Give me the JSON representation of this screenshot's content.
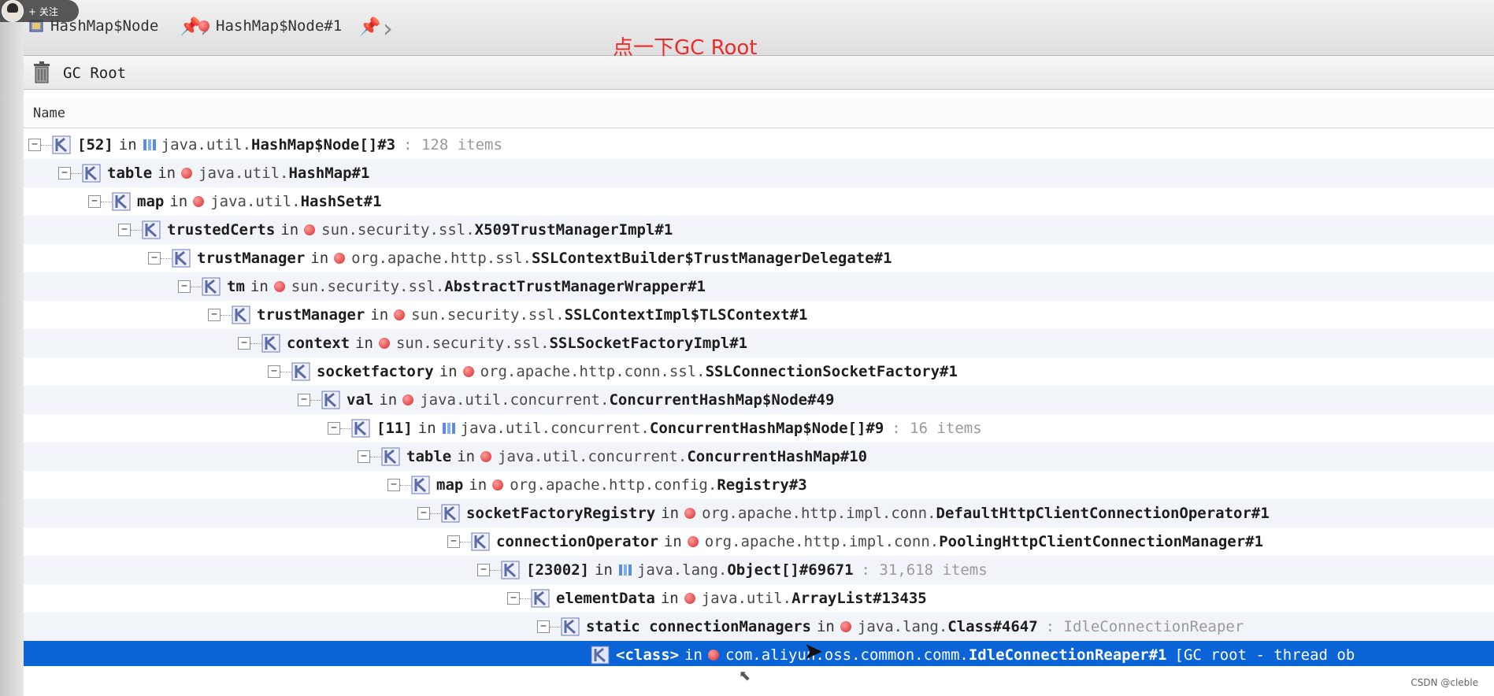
{
  "follow_badge": {
    "label": "+ 关注"
  },
  "breadcrumb": {
    "items": [
      {
        "label": "HashMap$Node"
      },
      {
        "label": "HashMap$Node#1"
      }
    ]
  },
  "annotation": "点一下GC Root",
  "gc_bar": {
    "label": "GC Root"
  },
  "column_header": {
    "name": "Name"
  },
  "tree": [
    {
      "field": "[52]",
      "in": "in",
      "pkg": "java.util.",
      "cls": "HashMap$Node[]#3",
      "extra": ": 128 items",
      "icon": "array"
    },
    {
      "field": "table",
      "in": "in",
      "pkg": "java.util.",
      "cls": "HashMap#1",
      "extra": "",
      "icon": "object"
    },
    {
      "field": "map",
      "in": "in",
      "pkg": "java.util.",
      "cls": "HashSet#1",
      "extra": "",
      "icon": "object"
    },
    {
      "field": "trustedCerts",
      "in": "in",
      "pkg": "sun.security.ssl.",
      "cls": "X509TrustManagerImpl#1",
      "extra": "",
      "icon": "object"
    },
    {
      "field": "trustManager",
      "in": "in",
      "pkg": "org.apache.http.ssl.",
      "cls": "SSLContextBuilder$TrustManagerDelegate#1",
      "extra": "",
      "icon": "object"
    },
    {
      "field": "tm",
      "in": "in",
      "pkg": "sun.security.ssl.",
      "cls": "AbstractTrustManagerWrapper#1",
      "extra": "",
      "icon": "object"
    },
    {
      "field": "trustManager",
      "in": "in",
      "pkg": "sun.security.ssl.",
      "cls": "SSLContextImpl$TLSContext#1",
      "extra": "",
      "icon": "object"
    },
    {
      "field": "context",
      "in": "in",
      "pkg": "sun.security.ssl.",
      "cls": "SSLSocketFactoryImpl#1",
      "extra": "",
      "icon": "object"
    },
    {
      "field": "socketfactory",
      "in": "in",
      "pkg": "org.apache.http.conn.ssl.",
      "cls": "SSLConnectionSocketFactory#1",
      "extra": "",
      "icon": "object"
    },
    {
      "field": "val",
      "in": "in",
      "pkg": "java.util.concurrent.",
      "cls": "ConcurrentHashMap$Node#49",
      "extra": "",
      "icon": "object"
    },
    {
      "field": "[11]",
      "in": "in",
      "pkg": "java.util.concurrent.",
      "cls": "ConcurrentHashMap$Node[]#9",
      "extra": ": 16 items",
      "icon": "array"
    },
    {
      "field": "table",
      "in": "in",
      "pkg": "java.util.concurrent.",
      "cls": "ConcurrentHashMap#10",
      "extra": "",
      "icon": "object"
    },
    {
      "field": "map",
      "in": "in",
      "pkg": "org.apache.http.config.",
      "cls": "Registry#3",
      "extra": "",
      "icon": "object"
    },
    {
      "field": "socketFactoryRegistry",
      "in": "in",
      "pkg": "org.apache.http.impl.conn.",
      "cls": "DefaultHttpClientConnectionOperator#1",
      "extra": "",
      "icon": "object"
    },
    {
      "field": "connectionOperator",
      "in": "in",
      "pkg": "org.apache.http.impl.conn.",
      "cls": "PoolingHttpClientConnectionManager#1",
      "extra": "",
      "icon": "object"
    },
    {
      "field": "[23002]",
      "in": "in",
      "pkg": "java.lang.",
      "cls": "Object[]#69671",
      "extra": ": 31,618 items",
      "icon": "array"
    },
    {
      "field": "elementData",
      "in": "in",
      "pkg": "java.util.",
      "cls": "ArrayList#13435",
      "extra": "",
      "icon": "object"
    },
    {
      "field": "static connectionManagers",
      "in": "in",
      "pkg": "java.lang.",
      "cls": "Class#4647",
      "extra": ": IdleConnectionReaper",
      "icon": "object"
    },
    {
      "field": "<class>",
      "in": "in",
      "pkg": "com.aliyun.oss.common.comm.",
      "cls": "IdleConnectionReaper#1",
      "extra": "[GC root - thread ob",
      "icon": "object",
      "selected": true
    }
  ],
  "watermark": "CSDN @cleble",
  "colors": {
    "selection": "#0a64d6",
    "annotation": "#ee2a2a",
    "object_dot": "#d42b2b",
    "ref_icon": "#5b6aa8"
  }
}
